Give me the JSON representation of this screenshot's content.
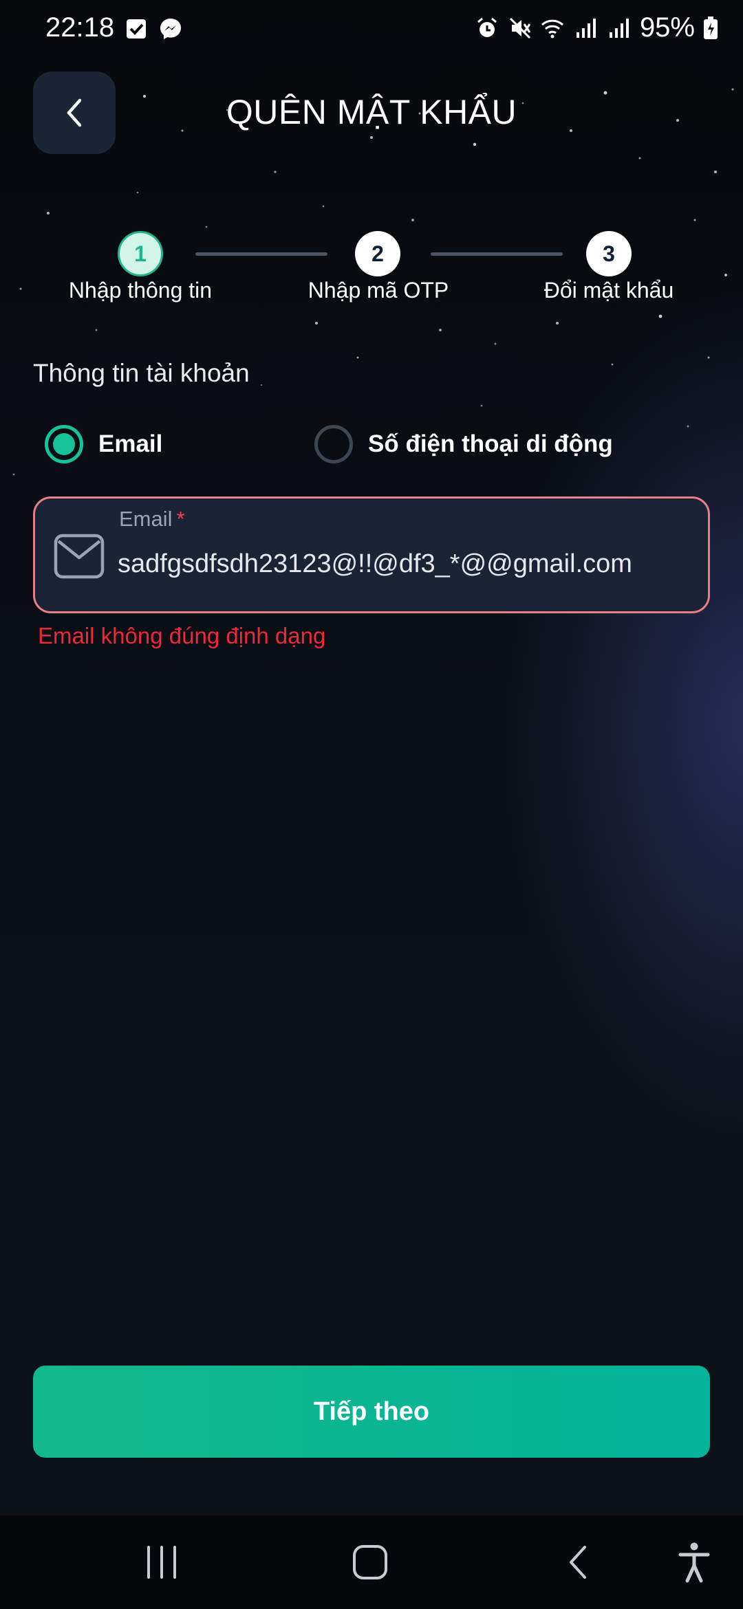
{
  "status_bar": {
    "time": "22:18",
    "battery": "95%",
    "left_icons": [
      "checkbox-icon",
      "messenger-icon"
    ],
    "right_icons": [
      "alarm-icon",
      "mute-icon",
      "wifi-icon",
      "signal-icon",
      "signal-icon",
      "battery-charging-icon"
    ]
  },
  "header": {
    "title": "QUÊN MẬT KHẨU",
    "back_icon": "chevron-left-icon"
  },
  "stepper": {
    "steps": [
      {
        "number": "1",
        "label": "Nhập thông tin",
        "state": "active"
      },
      {
        "number": "2",
        "label": "Nhập mã OTP",
        "state": "pending"
      },
      {
        "number": "3",
        "label": "Đổi mật khẩu",
        "state": "pending"
      }
    ]
  },
  "form": {
    "section_label": "Thông tin tài khoản",
    "radio_options": [
      {
        "label": "Email",
        "selected": true
      },
      {
        "label": "Số điện thoại di động",
        "selected": false
      }
    ],
    "email_field": {
      "label": "Email",
      "required_mark": "*",
      "value": "sadfgsdfsdh23123@!!@df3_*@@gmail.com",
      "icon": "mail-icon"
    },
    "error_message": "Email không đúng định dạng"
  },
  "next_button": {
    "label": "Tiếp theo"
  },
  "nav_bar": {
    "icons": [
      "recent-apps-icon",
      "home-icon",
      "back-icon",
      "accessibility-icon"
    ]
  },
  "colors": {
    "accent": "#16c29a",
    "error": "#f0263b",
    "field_border_error": "#e98086",
    "field_bg": "#1a2434"
  }
}
